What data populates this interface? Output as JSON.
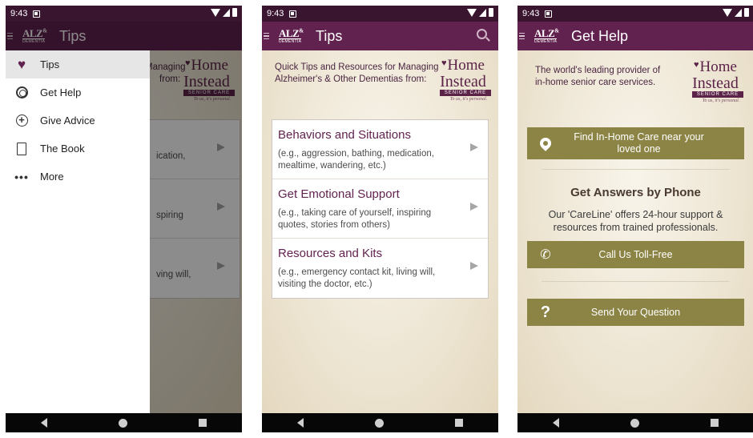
{
  "status": {
    "time": "9:43"
  },
  "appbar": {
    "logo_top": "ALZ",
    "logo_amp": "&",
    "logo_bottom": "DEMENTIA"
  },
  "logo_home_instead": {
    "line1": "Home",
    "line2": "Instead",
    "badge": "SENIOR CARE",
    "tagline": "To us, it's personal."
  },
  "screen1": {
    "title": "Tips",
    "drawer_items": [
      {
        "label": "Tips",
        "icon": "heart-icon",
        "active": true
      },
      {
        "label": "Get Help",
        "icon": "lifebuoy-icon",
        "active": false
      },
      {
        "label": "Give Advice",
        "icon": "advice-icon",
        "active": false
      },
      {
        "label": "The Book",
        "icon": "book-icon",
        "active": false
      },
      {
        "label": "More",
        "icon": "more-icon",
        "active": false
      }
    ],
    "bg_peek": {
      "intro_line1": "Managing",
      "intro_line2": "from:",
      "row1": "ication,",
      "row2": "spiring",
      "row3": "ving will,"
    }
  },
  "screen2": {
    "title": "Tips",
    "intro": "Quick Tips and Resources for Managing Alzheimer's & Other Dementias from:",
    "tips": [
      {
        "title": "Behaviors and Situations",
        "desc": "(e.g., aggression, bathing, medication, mealtime, wandering, etc.)"
      },
      {
        "title": "Get Emotional Support",
        "desc": "(e.g., taking care of yourself, inspiring quotes, stories from others)"
      },
      {
        "title": "Resources and Kits",
        "desc": "(e.g., emergency contact kit, living will, visiting the doctor, etc.)"
      }
    ]
  },
  "screen3": {
    "title": "Get Help",
    "intro": "The world's leading provider of in-home senior care services.",
    "find_care_button": "Find In-Home Care near your loved one",
    "phone_heading": "Get Answers by Phone",
    "phone_sub": "Our 'CareLine' offers 24-hour support & resources from trained professionals.",
    "call_button": "Call Us Toll-Free",
    "question_button": "Send Your Question"
  },
  "colors": {
    "appbar": "#62224f",
    "statusbar": "#3a1530",
    "olive_button": "#8c8445",
    "tip_title": "#62224f"
  }
}
